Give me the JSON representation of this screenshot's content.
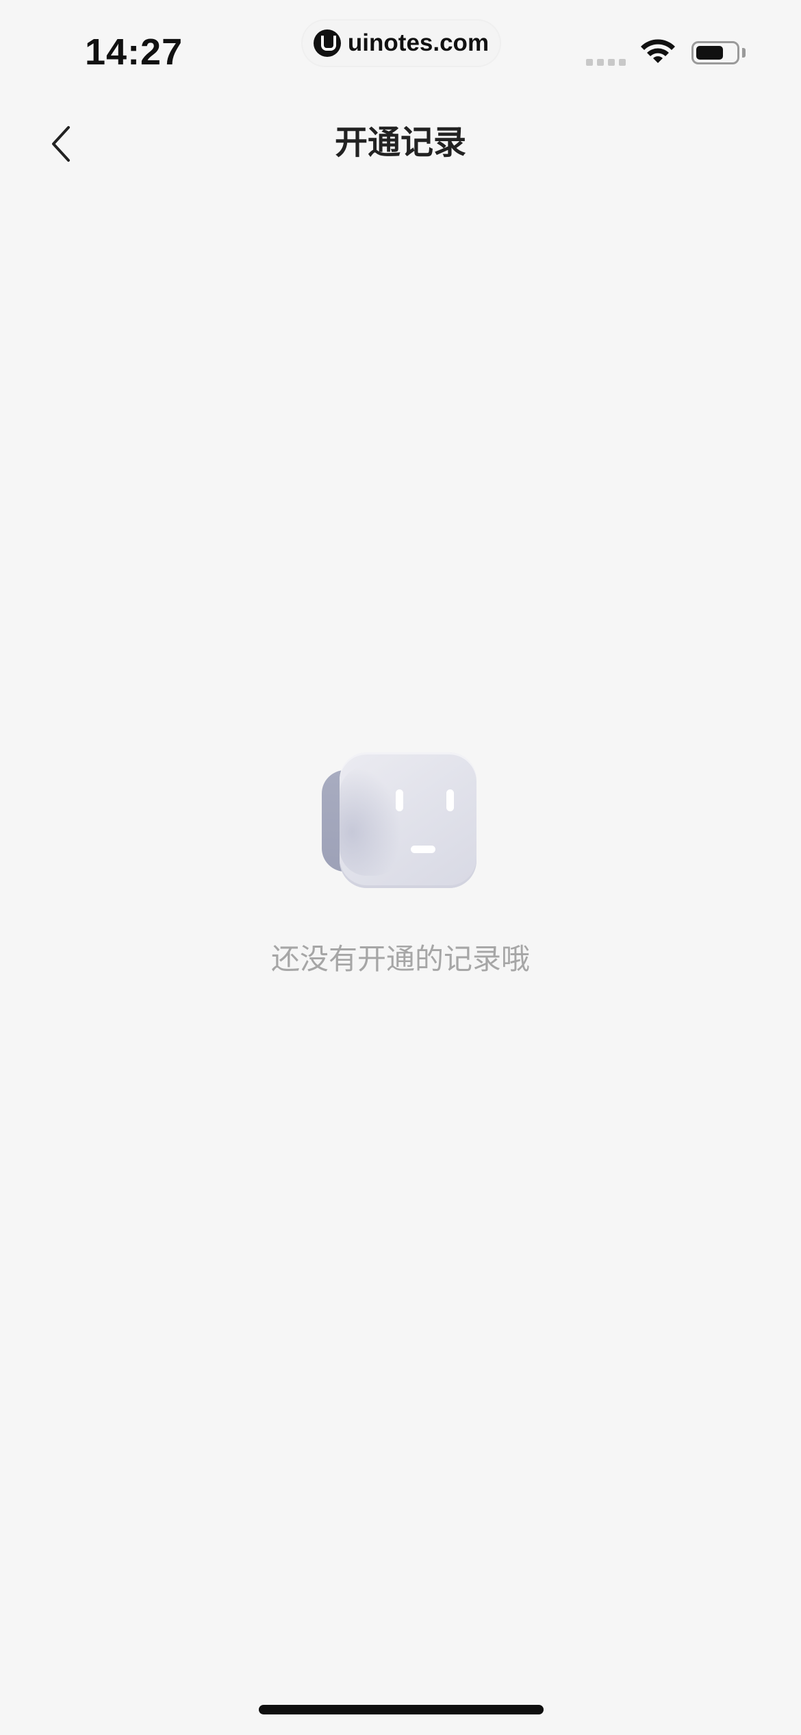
{
  "status_bar": {
    "time": "14:27",
    "url": "uinotes.com",
    "battery_level": 0.7,
    "icons": [
      "signal-icon",
      "wifi-icon",
      "battery-icon"
    ]
  },
  "nav": {
    "title": "开通记录",
    "back_icon": "chevron-left-icon"
  },
  "empty_state": {
    "illustration": "empty-face-cube-icon",
    "message": "还没有开通的记录哦"
  },
  "colors": {
    "background": "#f6f6f6",
    "title": "#222222",
    "empty_text": "#a6a6a6",
    "illustration_face": "#e2e3eb",
    "illustration_side": "#a1a5ba"
  }
}
